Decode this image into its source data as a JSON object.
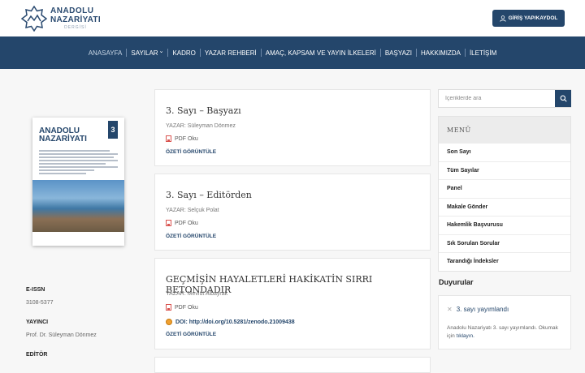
{
  "header": {
    "logo_line1": "ANADOLU",
    "logo_line2": "NAZARİYATI",
    "logo_line3": "DERGİSİ",
    "login_label": "GİRİŞ YAP/KAYDOL"
  },
  "nav": {
    "items": [
      {
        "label": "ANASAYFA"
      },
      {
        "label": "SAYILAR"
      },
      {
        "label": "KADRO"
      },
      {
        "label": "YAZAR REHBERİ"
      },
      {
        "label": "AMAÇ, KAPSAM VE YAYIN İLKELERİ"
      },
      {
        "label": "BAŞYAZI"
      },
      {
        "label": "HAKKIMIZDA"
      },
      {
        "label": "İLETİŞİM"
      }
    ],
    "dropdown_caret": "⌄"
  },
  "cover": {
    "title_line1": "ANADOLU",
    "title_line2": "NAZARİYATI",
    "issue_number": "3"
  },
  "sidebar_info": {
    "eissn_label": "E-ISSN",
    "eissn_value": "3108-5377",
    "publisher_label": "YAYINCI",
    "publisher_value": "Prof. Dr. Süleyman Dönmez",
    "editor_label": "EDİTÖR"
  },
  "articles": [
    {
      "title": "3. Sayı – Başyazı",
      "author": "YAZAR: Süleyman Dönmez",
      "pdf_label": "PDF Oku",
      "ozet_label": "ÖZETİ GÖRÜNTÜLE"
    },
    {
      "title": "3. Sayı – Editörden",
      "author": "YAZAR: Selçuk Polat",
      "pdf_label": "PDF Oku",
      "ozet_label": "ÖZETİ GÖRÜNTÜLE"
    },
    {
      "title": "GEÇMİŞİN HAYALETLERİ HAKİKATİN SIRRI BETONDADIR",
      "author": "YAZAR: Mevlüt Albayrak",
      "pdf_label": "PDF Oku",
      "doi_label": "DOI: http://doi.org/10.5281/zenodo.21009438",
      "ozet_label": "ÖZETİ GÖRÜNTÜLE"
    }
  ],
  "search": {
    "placeholder": "İçeriklerde ara"
  },
  "menu": {
    "heading": "MENÜ",
    "items": [
      {
        "label": "Son Sayı"
      },
      {
        "label": "Tüm Sayılar"
      },
      {
        "label": "Panel"
      },
      {
        "label": "Makale Gönder"
      },
      {
        "label": "Hakemlik Başvurusu"
      },
      {
        "label": "Sık Sorulan Sorular"
      },
      {
        "label": "Tarandığı İndeksler"
      }
    ]
  },
  "announcements": {
    "heading": "Duyurular",
    "item_title": "3. sayı yayımlandı",
    "item_text": "Anadolu Nazariyatı 3. sayı yayımlandı. Okumak için",
    "item_link": "tıklayın."
  },
  "colors": {
    "brand": "#24466b",
    "background": "#f7f7f7"
  }
}
